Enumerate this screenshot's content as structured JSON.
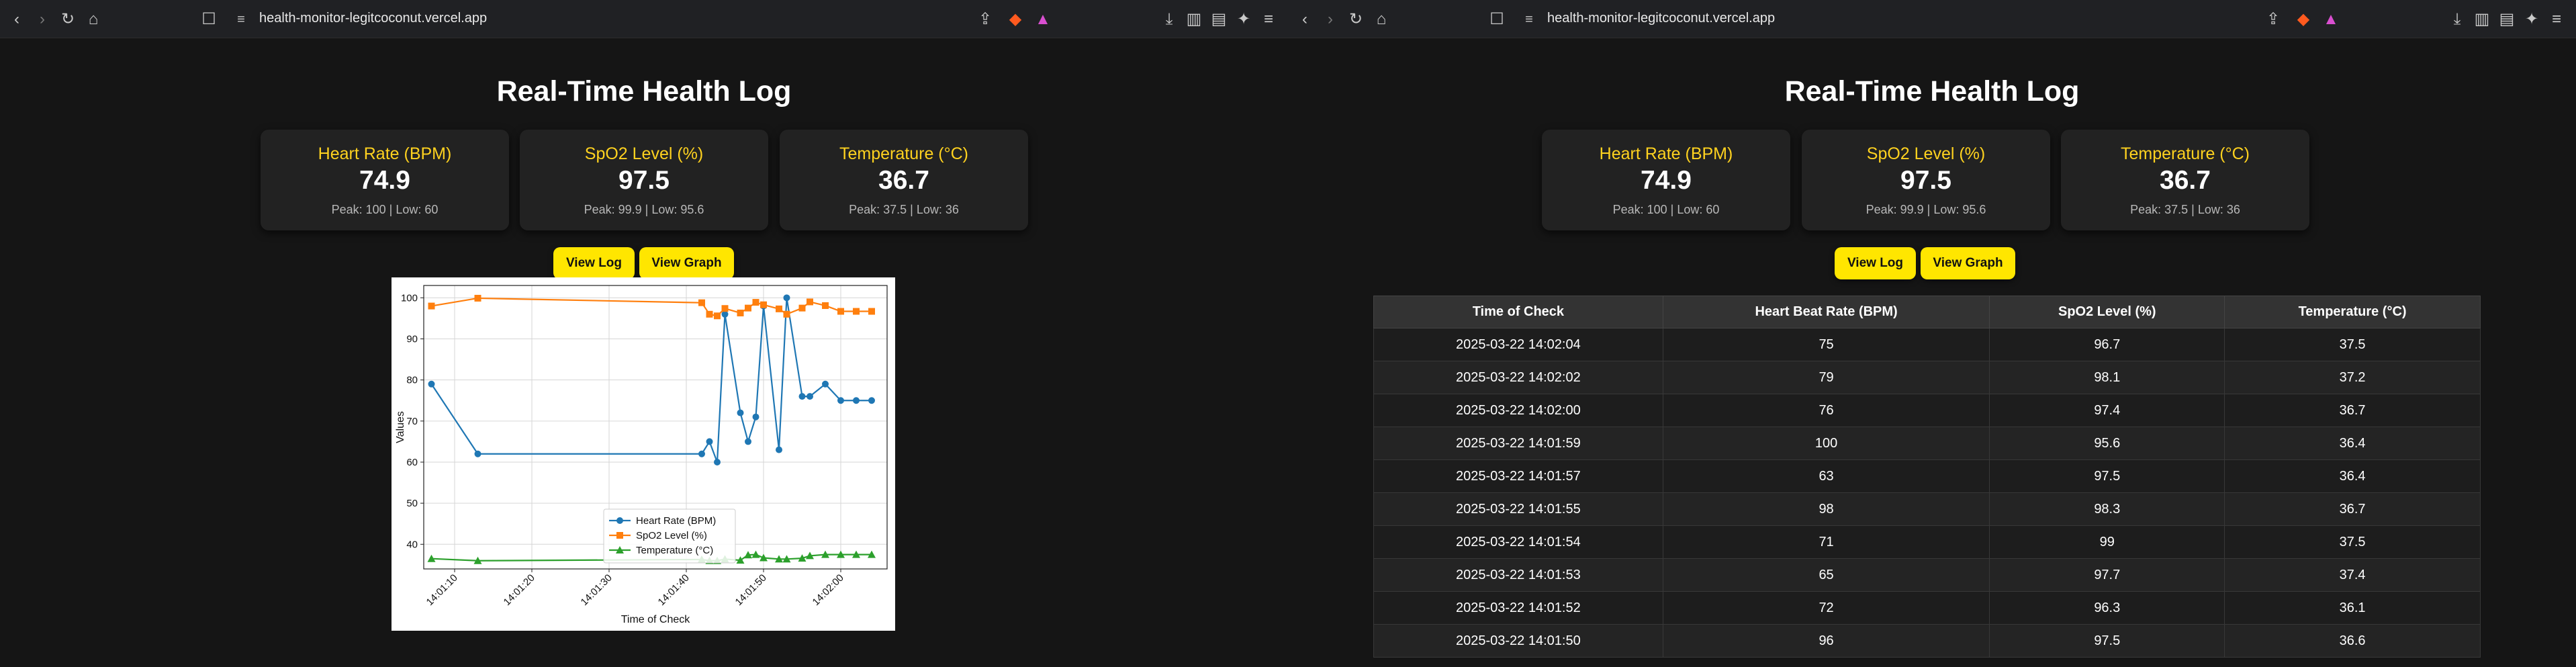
{
  "browser": {
    "url": "health-monitor-legitcoconut.vercel.app"
  },
  "page": {
    "title": "Real-Time Health Log"
  },
  "cards": [
    {
      "label": "Heart Rate (BPM)",
      "value": "74.9",
      "peak": "Peak: 100 | Low: 60"
    },
    {
      "label": "SpO2 Level (%)",
      "value": "97.5",
      "peak": "Peak: 99.9 | Low: 95.6"
    },
    {
      "label": "Temperature (°C)",
      "value": "36.7",
      "peak": "Peak: 37.5 | Low: 36"
    }
  ],
  "buttons": {
    "view_log": "View Log",
    "view_graph": "View Graph"
  },
  "colors": {
    "accent": "#ffe600",
    "label": "#ffd21f",
    "hr": "#1f77b4",
    "spo2": "#ff7f0e",
    "temp": "#2ca02c"
  },
  "chart_data": {
    "type": "line",
    "xlabel": "Time of Check",
    "ylabel": "Values",
    "ylim": [
      34,
      103
    ],
    "y_ticks": [
      40,
      50,
      60,
      70,
      80,
      90,
      100
    ],
    "x_ticks": [
      "14:01:10",
      "14:01:20",
      "14:01:30",
      "14:01:40",
      "14:01:50",
      "14:02:00"
    ],
    "xlim": [
      66,
      126
    ],
    "grid": true,
    "legend_position": "lower center",
    "x": [
      67,
      73,
      102,
      103,
      104,
      105,
      107,
      108,
      109,
      110,
      112,
      113,
      115,
      116,
      118,
      120,
      122,
      124
    ],
    "series": [
      {
        "name": "Heart Rate (BPM)",
        "marker": "circle",
        "values": [
          79,
          62,
          62,
          65,
          60,
          96,
          72,
          65,
          71,
          98,
          63,
          100,
          76,
          76,
          79,
          75,
          75,
          75
        ]
      },
      {
        "name": "SpO2 Level (%)",
        "marker": "square",
        "values": [
          98,
          99.9,
          98.8,
          96,
          95.6,
          97.4,
          96.3,
          97.5,
          98.9,
          98.3,
          97.3,
          96,
          97.5,
          99,
          98.1,
          96.7,
          96.7,
          96.7
        ]
      },
      {
        "name": "Temperature (°C)",
        "marker": "triangle",
        "values": [
          36.5,
          36,
          36.3,
          36,
          36,
          36.4,
          36.1,
          37.4,
          37.5,
          36.7,
          36.4,
          36.4,
          36.6,
          37.2,
          37.5,
          37.5,
          37.5,
          37.5
        ]
      }
    ]
  },
  "table": {
    "headers": [
      "Time of Check",
      "Heart Beat Rate (BPM)",
      "SpO2 Level (%)",
      "Temperature (°C)"
    ],
    "rows": [
      [
        "2025-03-22 14:02:04",
        "75",
        "96.7",
        "37.5"
      ],
      [
        "2025-03-22 14:02:02",
        "79",
        "98.1",
        "37.2"
      ],
      [
        "2025-03-22 14:02:00",
        "76",
        "97.4",
        "36.7"
      ],
      [
        "2025-03-22 14:01:59",
        "100",
        "95.6",
        "36.4"
      ],
      [
        "2025-03-22 14:01:57",
        "63",
        "97.5",
        "36.4"
      ],
      [
        "2025-03-22 14:01:55",
        "98",
        "98.3",
        "36.7"
      ],
      [
        "2025-03-22 14:01:54",
        "71",
        "99",
        "37.5"
      ],
      [
        "2025-03-22 14:01:53",
        "65",
        "97.7",
        "37.4"
      ],
      [
        "2025-03-22 14:01:52",
        "72",
        "96.3",
        "36.1"
      ],
      [
        "2025-03-22 14:01:50",
        "96",
        "97.5",
        "36.6"
      ]
    ]
  }
}
